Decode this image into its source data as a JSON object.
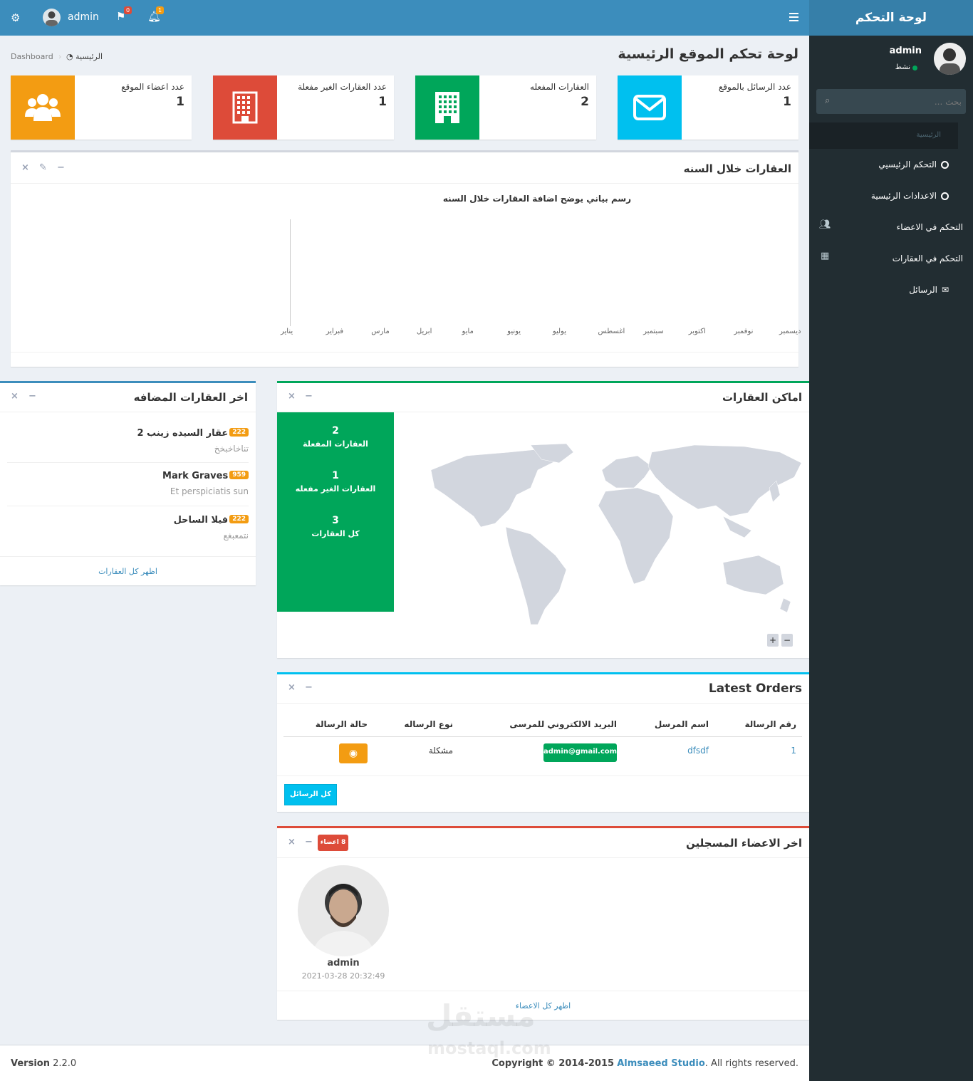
{
  "header": {
    "username": "admin",
    "flag_count": "0",
    "bell_count": "1"
  },
  "sidebar": {
    "logo": "لوحة التحكم",
    "user_name": "admin",
    "user_status": "نشط",
    "search_placeholder": "بحث ...",
    "section": "الرئيسية",
    "items": [
      {
        "label": "التحكم الرئيسيي"
      },
      {
        "label": "الاعدادات الرئيسية"
      },
      {
        "label": "التحكم في الاعضاء"
      },
      {
        "label": "التحكم في العقارات"
      },
      {
        "label": "الرسائل"
      }
    ]
  },
  "page": {
    "title": "لوحة تحكم الموقع الرئيسية",
    "breadcrumb_home": "الرئيسية",
    "breadcrumb_current": "Dashboard"
  },
  "info": [
    {
      "label": "عدد الرسائل بالموقع",
      "value": "1",
      "color": "#00c0ef"
    },
    {
      "label": "العقارات المفعله",
      "value": "2",
      "color": "#00a65a"
    },
    {
      "label": "عدد العقارات الغير مفعلة",
      "value": "1",
      "color": "#dd4b39"
    },
    {
      "label": "عدد اعضاء الموقع",
      "value": "1",
      "color": "#f39c12"
    }
  ],
  "chart_box": {
    "title": "العقارات خلال السنه"
  },
  "chart_data": {
    "type": "line",
    "title": "رسم بياني يوضح اضافة العقارات خلال السنه",
    "categories": [
      "ديسمبر",
      "نوفمبر",
      "اكتوبر",
      "سبتمبر",
      "اغسطس",
      "يوليو",
      "يونيو",
      "مايو",
      "ابريل",
      "مارس",
      "فبراير",
      "يناير"
    ],
    "series": []
  },
  "map_box": {
    "title": "اماكن العقارات",
    "stats": [
      {
        "value": "2",
        "label": "العقارات المفعلة"
      },
      {
        "value": "1",
        "label": "العقارات الغير مفعله"
      },
      {
        "value": "3",
        "label": "كل العقارات"
      }
    ],
    "zoom_in": "+",
    "zoom_out": "−"
  },
  "latest_products": {
    "title": "اخر العقارات المضافه",
    "items": [
      {
        "title": "عقار السيده زينب 2",
        "price": "222",
        "desc": "تناخاخبخخ"
      },
      {
        "title": "Mark Graves",
        "price": "959",
        "desc": "Et perspiciatis sun"
      },
      {
        "title": "فيلا الساحل",
        "price": "222",
        "desc": "نتمعبغع"
      }
    ],
    "footer": "اظهر كل العقارات"
  },
  "orders": {
    "title": "Latest Orders",
    "headers": [
      "رقم الرسالة",
      "اسم المرسل",
      "البريد الالكتروني للمرسى",
      "نوع الرساله",
      "حالة الرسالة"
    ],
    "rows": [
      {
        "id": "1",
        "name": "dfsdf",
        "email": "admin@gmail.com",
        "type": "مشكلة"
      }
    ],
    "button": "كل الرسائل"
  },
  "members": {
    "title": "اخر الاعضاء المسجلين",
    "badge": "8 اعضاء",
    "member_name": "admin",
    "member_date": "2021-03-28 20:32:49",
    "footer": "اظهر كل الاعضاء"
  },
  "footer": {
    "version_label": "Version",
    "version": "2.2.0",
    "copyright_pre": "Copyright © 2014-2015",
    "studio": "Almsaeed Studio",
    "copyright_post": ". All rights reserved."
  },
  "watermark": {
    "brand": "مستقل",
    "domain": "mostaql.com"
  }
}
